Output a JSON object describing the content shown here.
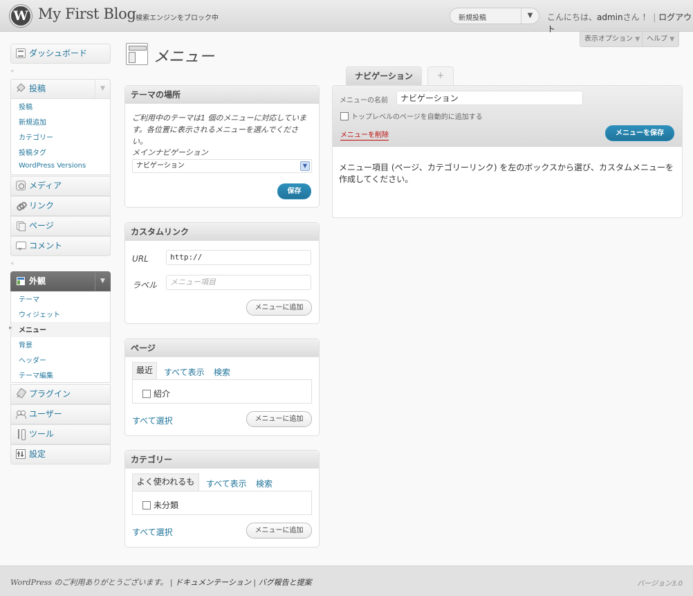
{
  "header": {
    "logo_letter": "W",
    "site_title": "My First Blog",
    "visibility": "検索エンジンをブロック中",
    "favorite_action": "新規投稿",
    "greeting": "こんにちは、",
    "username": "admin",
    "greeting_suffix": "さん ！",
    "separator": "|",
    "logout": "ログアウト"
  },
  "screen_meta": {
    "options_label": "表示オプション",
    "help_label": "ヘルプ"
  },
  "sidebar": {
    "dashboard": "ダッシュボード",
    "posts": "投稿",
    "posts_sub": [
      "投稿",
      "新規追加",
      "カテゴリー",
      "投稿タグ",
      "WordPress Versions"
    ],
    "media": "メディア",
    "links": "リンク",
    "pages": "ページ",
    "comments": "コメント",
    "appearance": "外観",
    "appearance_sub": [
      "テーマ",
      "ウィジェット",
      "メニュー",
      "背景",
      "ヘッダー",
      "テーマ編集"
    ],
    "plugins": "プラグイン",
    "users": "ユーザー",
    "tools": "ツール",
    "settings": "設定"
  },
  "page": {
    "title": "メニュー"
  },
  "theme_locations": {
    "title": "テーマの場所",
    "description": "ご利用中のテーマは1 個のメニューに対応しています。各位置に表示されるメニューを選んでください。",
    "location_label": "メインナビゲーション",
    "selected_menu": "ナビゲーション",
    "save_button": "保存"
  },
  "custom_links": {
    "title": "カスタムリンク",
    "url_label": "URL",
    "url_value": "http://",
    "label_label": "ラベル",
    "label_placeholder": "メニュー項目",
    "add_button": "メニューに追加"
  },
  "pages_box": {
    "title": "ページ",
    "tabs": [
      "最近",
      "すべて表示",
      "検索"
    ],
    "items": [
      "紹介"
    ],
    "select_all": "すべて選択",
    "add_button": "メニューに追加"
  },
  "categories_box": {
    "title": "カテゴリー",
    "tabs": [
      "よく使われるもの",
      "すべて表示",
      "検索"
    ],
    "items": [
      "未分類"
    ],
    "select_all": "すべて選択",
    "add_button": "メニューに追加"
  },
  "menu_editor": {
    "active_tab": "ナビゲーション",
    "add_tab": "+",
    "name_label": "メニューの名前",
    "name_value": "ナビゲーション",
    "auto_add_label": "トップレベルのページを自動的に追加する",
    "delete_link": "メニューを削除",
    "save_button": "メニューを保存",
    "instructions": "メニュー項目 (ページ、カテゴリーリンク) を左のボックスから選び、カスタムメニューを作成してください。"
  },
  "footer": {
    "wordpress": "WordPress",
    "thanks": " のご利用ありがとうございます。",
    "separator": "|",
    "documentation": " ドキュメンテーション ",
    "bug_report": " バグ報告と提案",
    "version": "バージョン3.0"
  },
  "colors": {
    "link": "#21759b",
    "primary_button": "#21759b",
    "delete": "#bc0b0b",
    "header_bg": "#e4e4e4"
  }
}
